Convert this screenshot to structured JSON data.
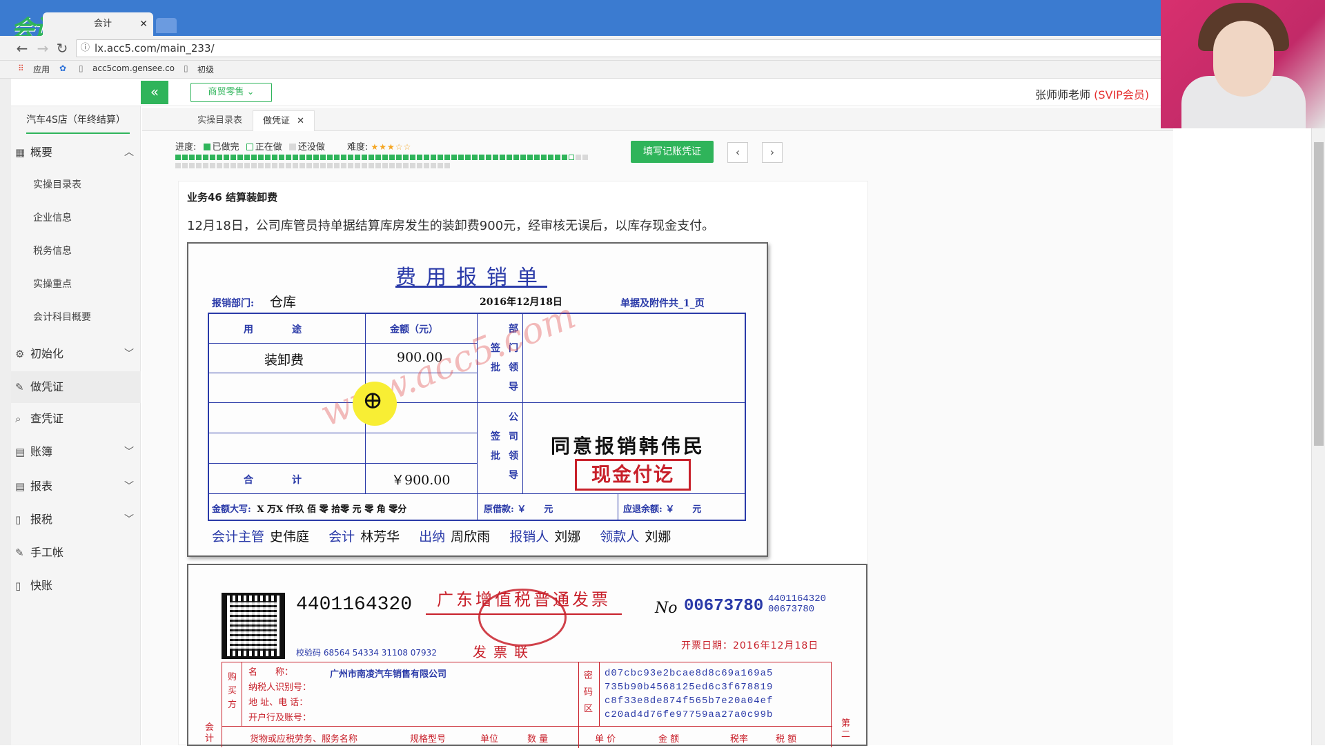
{
  "browser": {
    "tab_title": "会计学堂",
    "tab_title2": "会计",
    "address": "lx.acc5.com/main_233/",
    "bookmarks": [
      "应用",
      "acc5com.gensee.co",
      "初级"
    ],
    "logo_text": "会计学堂"
  },
  "header": {
    "industry": "商贸零售",
    "teacher": "张师师老师",
    "member": "(SVIP会员)"
  },
  "sidebar": {
    "company": "汽车4S店（年终结算）",
    "menu": {
      "overview": "概要",
      "overview_items": [
        "实操目录表",
        "企业信息",
        "税务信息",
        "实操重点",
        "会计科目概要"
      ],
      "init": "初始化",
      "voucher": "做凭证",
      "query": "查凭证",
      "ledger": "账簿",
      "report": "报表",
      "tax": "报税",
      "manual": "手工帐",
      "quick": "快账"
    }
  },
  "tabs": [
    "实操目录表",
    "做凭证"
  ],
  "progress": {
    "label": "进度:",
    "done": "已做完",
    "doing": "正在做",
    "todo": "还没做",
    "difficulty_label": "难度:",
    "difficulty_stars": "★★★☆☆",
    "done_count": 57,
    "current_index": 57,
    "total": 100,
    "colors": {
      "done": "#2fb45a",
      "todo": "#d9d9d9"
    }
  },
  "actions": {
    "fill_voucher": "填写记账凭证",
    "prev": "‹",
    "next": "›"
  },
  "task": {
    "title": "业务46 结算装卸费",
    "description": "12月18日，公司库管员持单据结算库房发生的装卸费900元，经审核无误后，以库存现金支付。"
  },
  "receipt": {
    "title": "费用报销单",
    "dept_label": "报销部门:",
    "dept_value": "仓库",
    "date": "2016年12月18日",
    "attach": "单据及附件共_1_页",
    "col_use": "用　　　　途",
    "col_amount": "金额（元）",
    "dept_approve": [
      "部",
      "门",
      "签",
      "领",
      "批",
      "导"
    ],
    "co_approve": [
      "公",
      "司",
      "签",
      "领",
      "批",
      "导"
    ],
    "item_name": "装卸费",
    "item_amount": "900.00",
    "total_label": "合　　　　计",
    "total_amount": "￥900.00",
    "capital_label": "金额大写:",
    "capital_value": "X 万X 仟玖 佰 零 拾零 元 零 角 零分",
    "borrowed_label": "原借款: ￥　　元",
    "refund_label": "应退余额: ￥　　元",
    "approve_text": "同意报销韩伟民",
    "stamp": "现金付讫",
    "watermark": "www.acc5.com",
    "signers": [
      {
        "role": "会计主管",
        "name": "史伟庭"
      },
      {
        "role": "会计",
        "name": "林芳华"
      },
      {
        "role": "出纳",
        "name": "周欣雨"
      },
      {
        "role": "报销人",
        "name": "刘娜"
      },
      {
        "role": "领款人",
        "name": "刘娜"
      }
    ]
  },
  "invoice": {
    "code": "4401164320",
    "title": "广东增值税普通发票",
    "copy": "发票联",
    "no_label": "No",
    "no": "00673780",
    "code2": "4401164320",
    "no2": "00673780",
    "check": "校验码 68564 54334 31108 07932",
    "date": "开票日期：2016年12月18日",
    "buyer_label": "购买方",
    "fields": [
      "名　　称：",
      "纳税人识别号：",
      "地 址、电 话：",
      "开户行及账号："
    ],
    "buyer_name": "广州市南凌汽车销售有限公司",
    "cipher_label": "密码区",
    "cipher": [
      "d07cbc93e2bcae8d8c69a169a5",
      "735b90b4568125ed6c3f678819",
      "c8f33e8de874f565b7e20a04ef",
      "c20ad4d76fe97759aa27a0c99b"
    ],
    "cols": [
      "货物或应税劳务、服务名称",
      "规格型号",
      "单位",
      "数 量",
      "单 价",
      "金 额",
      "税率",
      "税 额"
    ],
    "side": "会计",
    "side2": "第二"
  }
}
